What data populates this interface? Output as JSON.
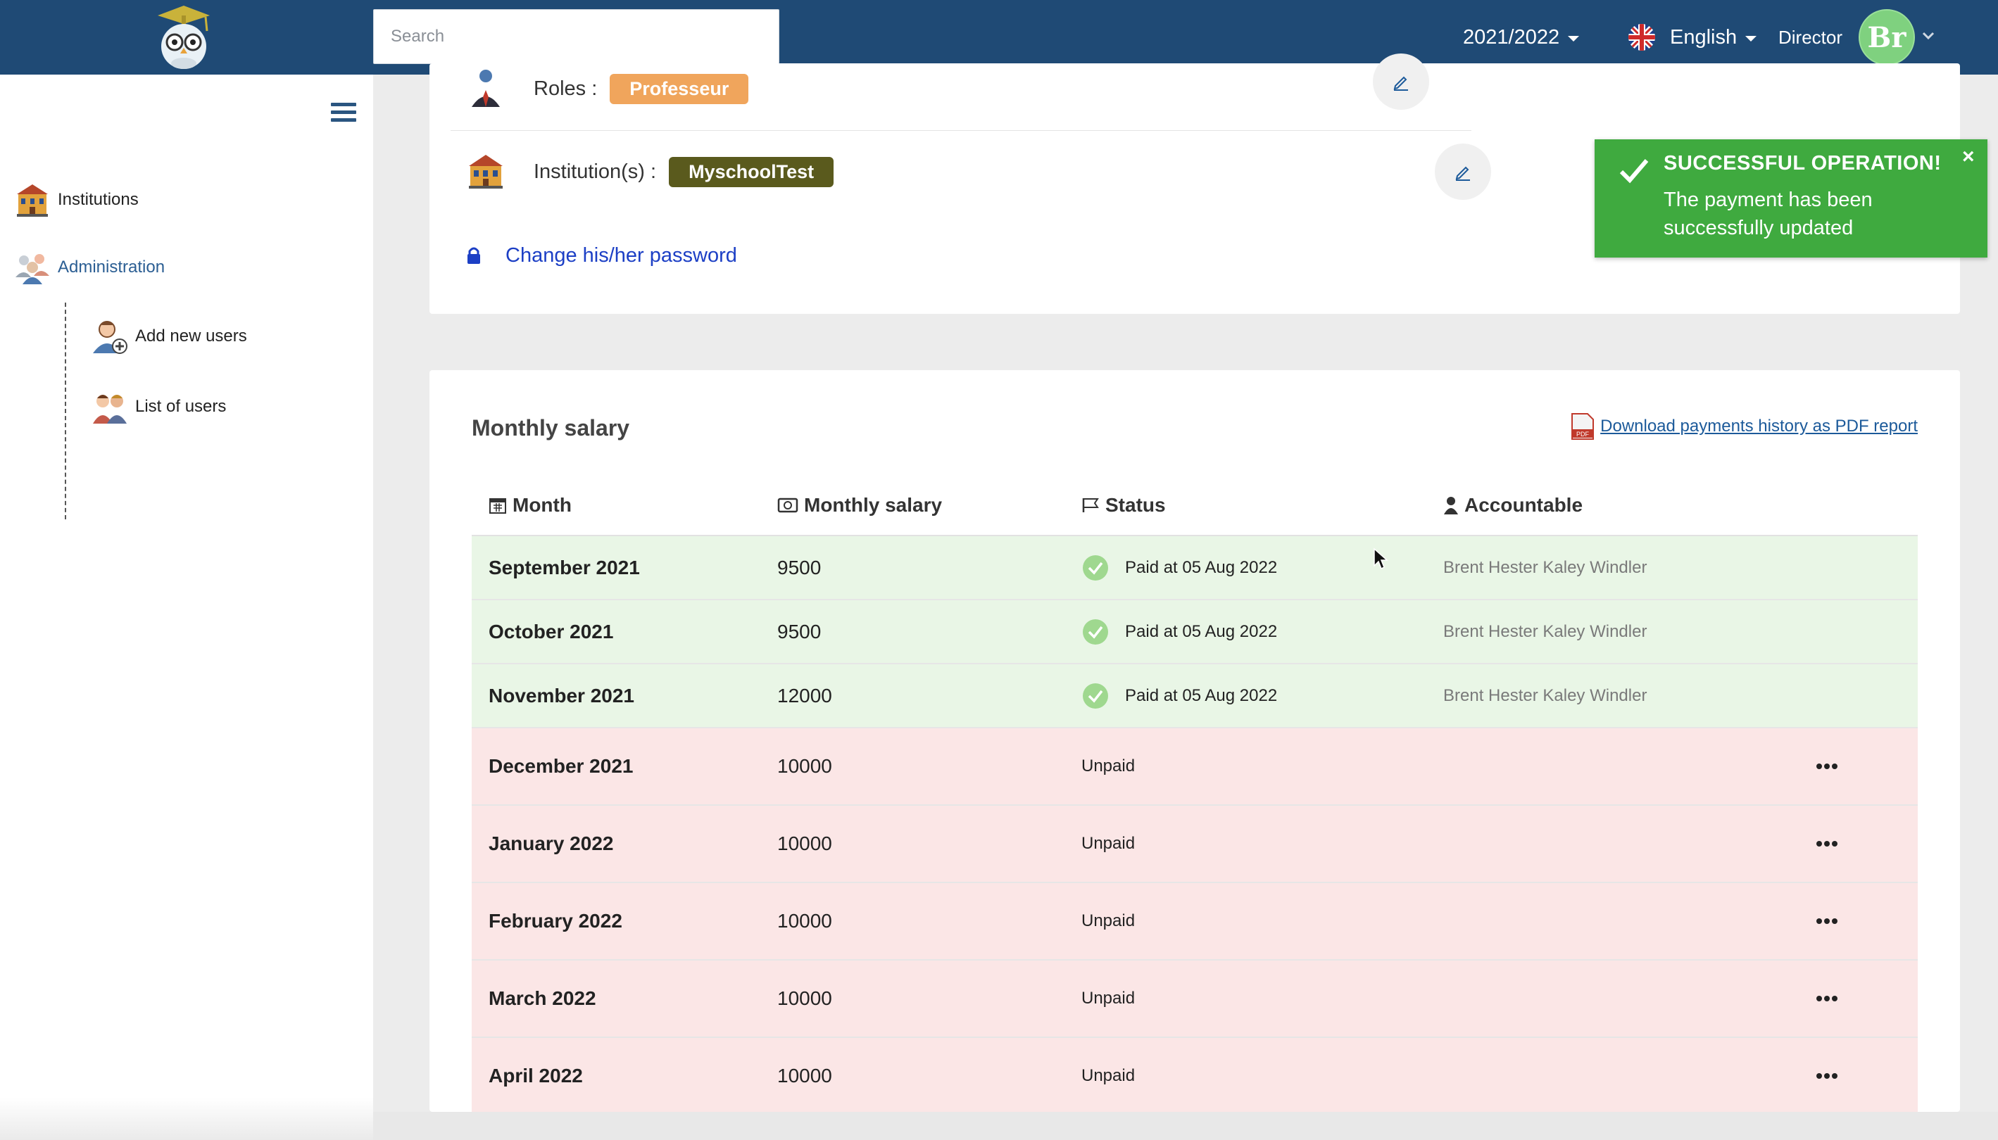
{
  "header": {
    "search_placeholder": "Search",
    "school_year": "2021/2022",
    "language": "English",
    "role": "Director",
    "avatar_initials": "Br"
  },
  "sidebar": {
    "items": [
      {
        "label": "Institutions",
        "icon": "school-building-icon"
      },
      {
        "label": "Administration",
        "icon": "admin-team-icon"
      },
      {
        "label": "Add new users",
        "icon": "add-user-icon"
      },
      {
        "label": "List of users",
        "icon": "users-group-icon"
      }
    ]
  },
  "profile": {
    "roles_label": "Roles :",
    "role_badge": "Professeur",
    "institutions_label": "Institution(s) :",
    "institution_badge": "MyschoolTest",
    "change_password": "Change his/her password"
  },
  "toast": {
    "title": "SUCCESSFUL OPERATION!",
    "message": "The payment has been successfully updated",
    "close": "×",
    "color": "#3faa3f"
  },
  "salary": {
    "title": "Monthly salary",
    "pdf_link": "Download payments history as PDF report",
    "columns": {
      "month": "Month",
      "salary": "Monthly salary",
      "status": "Status",
      "accountable": "Accountable"
    },
    "rows": [
      {
        "month": "September 2021",
        "salary": "9500",
        "status": "Paid at 05 Aug 2022",
        "accountable": "Brent Hester Kaley Windler",
        "paid": true
      },
      {
        "month": "October 2021",
        "salary": "9500",
        "status": "Paid at 05 Aug 2022",
        "accountable": "Brent Hester Kaley Windler",
        "paid": true
      },
      {
        "month": "November 2021",
        "salary": "12000",
        "status": "Paid at 05 Aug 2022",
        "accountable": "Brent Hester Kaley Windler",
        "paid": true
      },
      {
        "month": "December 2021",
        "salary": "10000",
        "status": "Unpaid",
        "accountable": "",
        "paid": false
      },
      {
        "month": "January 2022",
        "salary": "10000",
        "status": "Unpaid",
        "accountable": "",
        "paid": false
      },
      {
        "month": "February 2022",
        "salary": "10000",
        "status": "Unpaid",
        "accountable": "",
        "paid": false
      },
      {
        "month": "March 2022",
        "salary": "10000",
        "status": "Unpaid",
        "accountable": "",
        "paid": false
      },
      {
        "month": "April 2022",
        "salary": "10000",
        "status": "Unpaid",
        "accountable": "",
        "paid": false
      }
    ]
  },
  "colors": {
    "topbar": "#1f4a75",
    "paid_row": "#e9f6e6",
    "unpaid_row": "#fbe6e6",
    "role_badge": "#f0a55c",
    "institution_badge": "#5a5a1d",
    "link": "#1c3fc5"
  }
}
